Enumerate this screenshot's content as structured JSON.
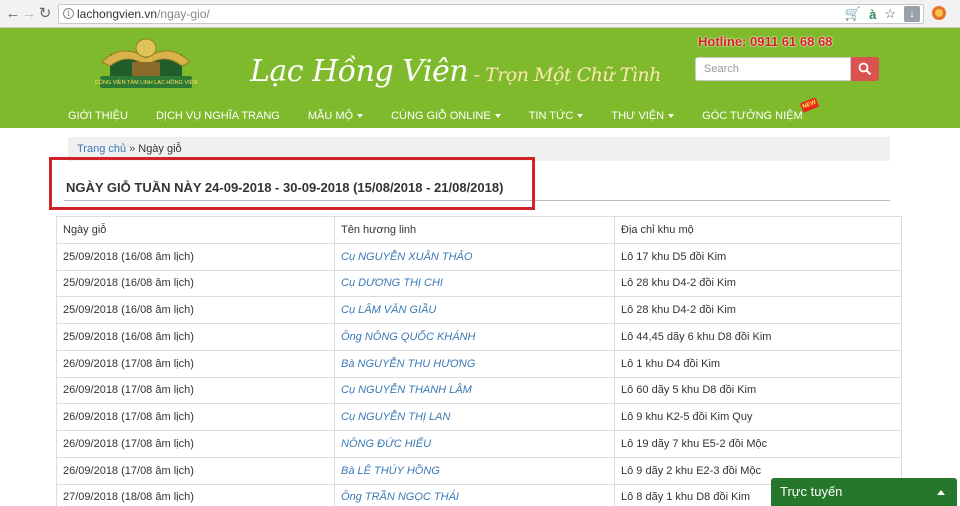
{
  "browser": {
    "url_host": "lachongvien.vn",
    "url_path": "/ngay-gio/"
  },
  "header": {
    "logo_caption": "CÔNG VIÊN TÂM LINH LẠC HỒNG VIÊN",
    "brand_name": "Lạc Hồng Viên",
    "brand_slogan": " - Trọn Một Chữ Tình",
    "hotline": "Hotline: 0911 61 68 68",
    "search_placeholder": "Search",
    "colors": {
      "header_bg": "#7fba2d",
      "hotline": "#d62020",
      "search_button": "#d9534f"
    }
  },
  "nav": {
    "items": [
      {
        "label": "GIỚI THIỆU"
      },
      {
        "label": "DỊCH VỤ NGHĨA TRANG"
      },
      {
        "label": "MẪU MỘ"
      },
      {
        "label": "CÚNG GIỖ ONLINE"
      },
      {
        "label": "TIN TỨC"
      },
      {
        "label": "THƯ VIỆN"
      },
      {
        "label": "GÓC TƯỞNG NIỆM"
      }
    ],
    "new_badge": "NEW"
  },
  "breadcrumb": {
    "home": "Trang chủ",
    "separator": "»",
    "current": "Ngày giỗ"
  },
  "page": {
    "title": "NGÀY GIỖ TUẦN NÀY 24-09-2018 - 30-09-2018 (15/08/2018 - 21/08/2018)"
  },
  "table": {
    "headers": [
      "Ngày giỗ",
      "Tên hương linh",
      "Địa chỉ khu mộ"
    ],
    "rows": [
      [
        "25/09/2018 (16/08 âm lịch)",
        "Cụ NGUYỄN XUÂN THẢO",
        "Lô 17 khu D5 đồi Kim"
      ],
      [
        "25/09/2018 (16/08 âm lịch)",
        "Cụ DƯƠNG THỊ CHI",
        "Lô 28 khu D4-2 đồi Kim"
      ],
      [
        "25/09/2018 (16/08 âm lịch)",
        "Cụ LÂM VĂN GIẦU",
        "Lô 28 khu D4-2 đồi Kim"
      ],
      [
        "25/09/2018 (16/08 âm lịch)",
        "Ông NÔNG QUỐC KHÁNH",
        "Lô 44,45 dãy 6 khu D8 đồi Kim"
      ],
      [
        "26/09/2018 (17/08 âm lịch)",
        "Bà NGUYỄN THU HƯƠNG",
        "Lô 1 khu D4 đồi Kim"
      ],
      [
        "26/09/2018 (17/08 âm lịch)",
        "Cụ NGUYỄN THANH LÂM",
        "Lô 60 dãy 5 khu D8 đồi Kim"
      ],
      [
        "26/09/2018 (17/08 âm lịch)",
        "Cụ NGUYỄN THỊ LAN",
        "Lô 9 khu K2-5 đồi Kim Quy"
      ],
      [
        "26/09/2018 (17/08 âm lịch)",
        "NÔNG ĐỨC HIẾU",
        "Lô 19 dãy 7 khu E5-2 đồi Mộc"
      ],
      [
        "26/09/2018 (17/08 âm lịch)",
        "Bà LÊ THÚY HỒNG",
        "Lô 9 dãy 2 khu E2-3 đồi Mộc"
      ],
      [
        "27/09/2018 (18/08 âm lịch)",
        "Ông TRẦN NGỌC THÁI",
        "Lô 8 dãy 1 khu D8 đồi Kim"
      ]
    ]
  },
  "chat": {
    "label": "Trực tuyến",
    "color": "#26772b"
  }
}
